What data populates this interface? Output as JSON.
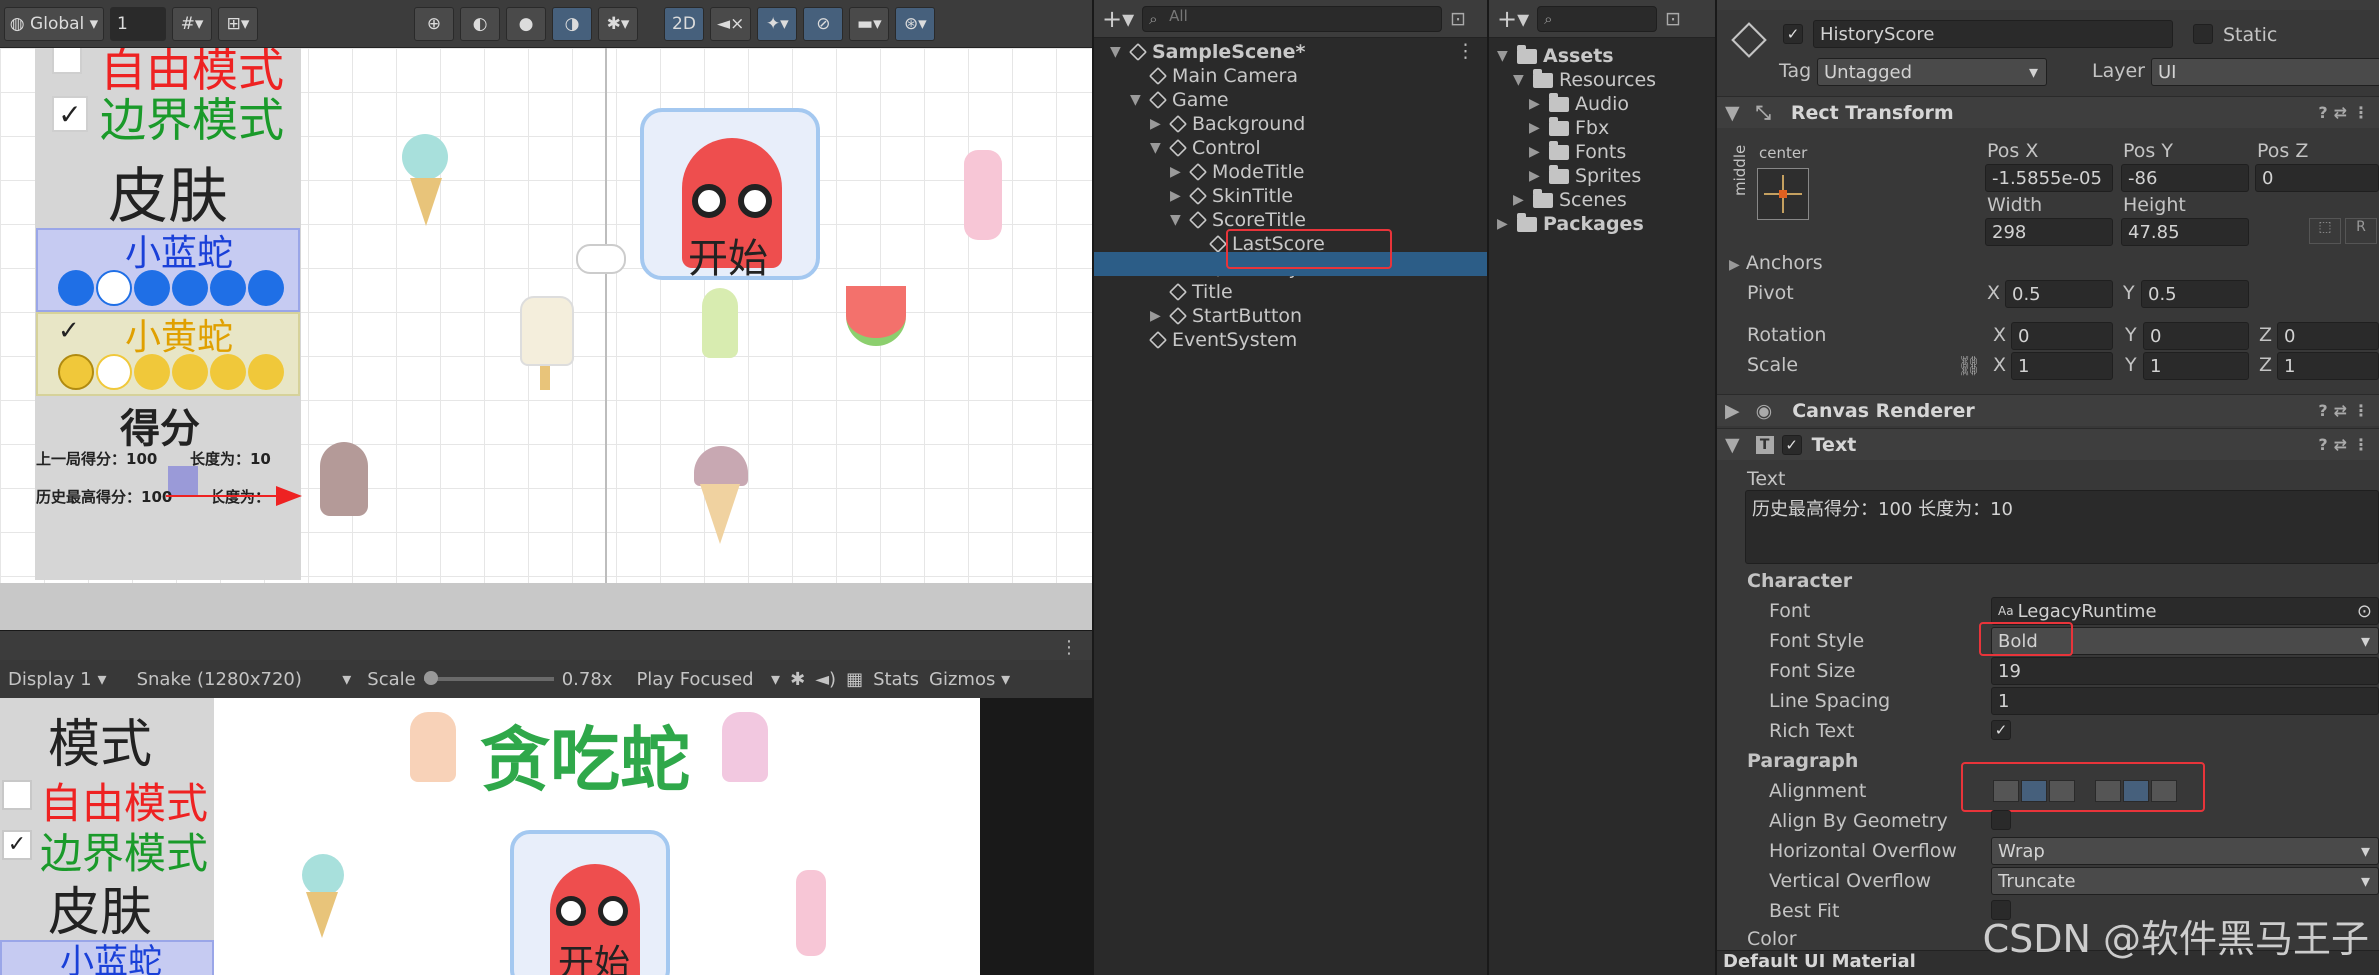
{
  "scene_toolbar": {
    "global_label": "Global",
    "grid_value": "1",
    "mode_2d": "2D"
  },
  "scene": {
    "labels": {
      "free_mode": "自由模式",
      "border_mode": "边界模式",
      "skin": "皮肤",
      "blue_snake": "小蓝蛇",
      "yellow_snake": "小黄蛇",
      "score": "得分",
      "last_score": "上一局得分：100",
      "last_length": "长度为：10",
      "history_score": "历史最高得分：100",
      "history_length": "长度为：",
      "start": "开始"
    }
  },
  "game_toolbar": {
    "display": "Display 1",
    "resolution": "Snake (1280x720)",
    "scale_label": "Scale",
    "scale_value": "0.78x",
    "play_focused": "Play Focused",
    "stats": "Stats",
    "gizmos": "Gizmos"
  },
  "game": {
    "mode": "模式",
    "free_mode": "自由模式",
    "border_mode": "边界模式",
    "skin": "皮肤",
    "blue_snake": "小蓝蛇",
    "title": "贪吃蛇",
    "start": "开始"
  },
  "hierarchy": {
    "search_placeholder": "All",
    "items": [
      {
        "label": "SampleScene*",
        "level": 0,
        "arrow": "▼"
      },
      {
        "label": "Main Camera",
        "level": 1,
        "arrow": ""
      },
      {
        "label": "Game",
        "level": 1,
        "arrow": "▼"
      },
      {
        "label": "Background",
        "level": 2,
        "arrow": "▶"
      },
      {
        "label": "Control",
        "level": 2,
        "arrow": "▼"
      },
      {
        "label": "ModeTitle",
        "level": 3,
        "arrow": "▶"
      },
      {
        "label": "SkinTitle",
        "level": 3,
        "arrow": "▶"
      },
      {
        "label": "ScoreTitle",
        "level": 3,
        "arrow": "▼"
      },
      {
        "label": "LastScore",
        "level": 4,
        "arrow": ""
      },
      {
        "label": "HistoryScore",
        "level": 4,
        "arrow": ""
      },
      {
        "label": "Title",
        "level": 2,
        "arrow": ""
      },
      {
        "label": "StartButton",
        "level": 2,
        "arrow": "▶"
      },
      {
        "label": "EventSystem",
        "level": 1,
        "arrow": ""
      }
    ]
  },
  "project": {
    "items": [
      {
        "label": "Assets",
        "level": 0
      },
      {
        "label": "Resources",
        "level": 1
      },
      {
        "label": "Audio",
        "level": 2
      },
      {
        "label": "Fbx",
        "level": 2
      },
      {
        "label": "Fonts",
        "level": 2
      },
      {
        "label": "Sprites",
        "level": 2
      },
      {
        "label": "Scenes",
        "level": 1
      },
      {
        "label": "Packages",
        "level": 0
      }
    ]
  },
  "inspector": {
    "object_name": "HistoryScore",
    "static_label": "Static",
    "tag_label": "Tag",
    "tag_value": "Untagged",
    "layer_label": "Layer",
    "layer_value": "UI",
    "rect_transform": "Rect Transform",
    "anchor_h": "center",
    "anchor_v": "middle",
    "pos_x_label": "Pos X",
    "pos_y_label": "Pos Y",
    "pos_z_label": "Pos Z",
    "pos_x": "-1.5855e-05",
    "pos_y": "-86",
    "pos_z": "0",
    "width_label": "Width",
    "height_label": "Height",
    "width": "298",
    "height": "47.85",
    "anchors": "Anchors",
    "pivot": "Pivot",
    "pivot_x": "0.5",
    "pivot_y": "0.5",
    "rotation": "Rotation",
    "rot_x": "0",
    "rot_y": "0",
    "rot_z": "0",
    "scale": "Scale",
    "scale_x": "1",
    "scale_y": "1",
    "scale_z": "1",
    "canvas_renderer": "Canvas Renderer",
    "text_component": "Text",
    "text_label": "Text",
    "text_value": "历史最高得分：100    长度为：10",
    "character": "Character",
    "font_label": "Font",
    "font_value": "LegacyRuntime",
    "font_style_label": "Font Style",
    "font_style_value": "Bold",
    "font_size_label": "Font Size",
    "font_size_value": "19",
    "line_spacing_label": "Line Spacing",
    "line_spacing_value": "1",
    "rich_text_label": "Rich Text",
    "paragraph": "Paragraph",
    "alignment_label": "Alignment",
    "align_by_geometry_label": "Align By Geometry",
    "h_overflow_label": "Horizontal Overflow",
    "h_overflow_value": "Wrap",
    "v_overflow_label": "Vertical Overflow",
    "v_overflow_value": "Truncate",
    "best_fit_label": "Best Fit",
    "color_label": "Color",
    "material_label": "Default UI Material"
  },
  "watermark": "CSDN @软件黑马王子",
  "colors": {
    "accent_red": "#e8343a",
    "selection_blue": "#2c5d87"
  }
}
